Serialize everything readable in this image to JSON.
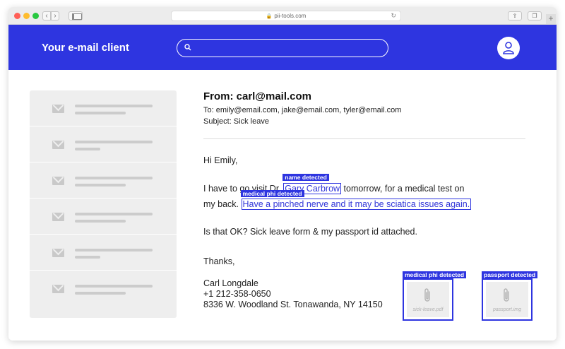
{
  "browser": {
    "url": "pii-tools.com"
  },
  "header": {
    "app_title": "Your e-mail client",
    "search_placeholder": ""
  },
  "email": {
    "from": "From: carl@mail.com",
    "to": "To: emily@email.com, jake@email.com, tyler@email.com",
    "subject": "Subject: Sick leave",
    "greeting": "Hi Emily,",
    "line1_before": "I have to go visit Dr. ",
    "line1_name": "Gary Carbrow",
    "line1_after": " tomorrow, for a medical test on",
    "line2_before": "my back. ",
    "line2_phi": "Have a pinched nerve and it may be sciatica issues again.",
    "line3": "Is that OK? Sick leave form & my passport id attached.",
    "signoff": "Thanks,",
    "sig_name": "Carl Longdale",
    "sig_phone": "+1 212-358-0650",
    "sig_address": "8336 W. Woodland St. Tonawanda, NY 14150"
  },
  "detections": {
    "name_tag": "name detected",
    "phi_tag": "medical phi detected",
    "attach1_tag": "medical phi detected",
    "attach2_tag": "passport detected"
  },
  "attachments": [
    {
      "filename": "sick-leave.pdf"
    },
    {
      "filename": "passport.img"
    }
  ],
  "inbox_count": 6,
  "colors": {
    "brand": "#2e35e0",
    "highlight_text": "#3136d8"
  }
}
